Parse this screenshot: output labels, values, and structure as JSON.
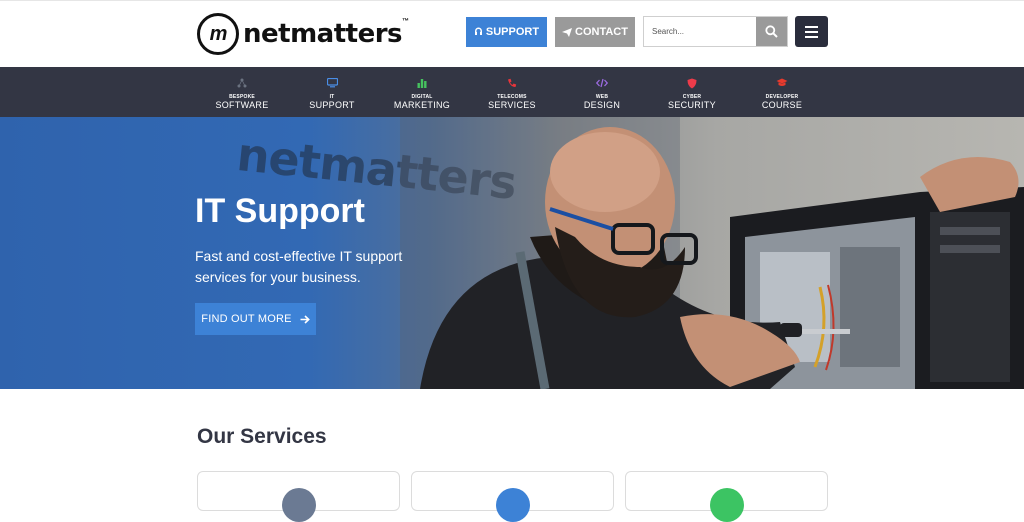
{
  "brand": {
    "name": "netmatters",
    "badge": "m",
    "tm": "™"
  },
  "header": {
    "support_label": "SUPPORT",
    "contact_label": "CONTACT",
    "search_placeholder": "Search..."
  },
  "nav": {
    "items": [
      {
        "small": "BESPOKE",
        "big": "SOFTWARE",
        "icon": "network-icon",
        "color": "#6b7280"
      },
      {
        "small": "IT",
        "big": "SUPPORT",
        "icon": "monitor-icon",
        "color": "#4a8ee6"
      },
      {
        "small": "DIGITAL",
        "big": "MARKETING",
        "icon": "bar-chart-icon",
        "color": "#46c35f"
      },
      {
        "small": "TELECOMS",
        "big": "SERVICES",
        "icon": "phone-icon",
        "color": "#e8353b"
      },
      {
        "small": "WEB",
        "big": "DESIGN",
        "icon": "code-icon",
        "color": "#9b6be0"
      },
      {
        "small": "CYBER",
        "big": "SECURITY",
        "icon": "shield-icon",
        "color": "#ee3b4a"
      },
      {
        "small": "DEVELOPER",
        "big": "COURSE",
        "icon": "graduation-cap-icon",
        "color": "#e83a2d"
      }
    ]
  },
  "hero": {
    "title": "IT Support",
    "subtitle": "Fast and cost-effective IT support services for your business.",
    "cta_label": "FIND OUT MORE",
    "wall_text": "netmatters"
  },
  "services": {
    "title": "Our Services",
    "card_colors": [
      "#6b7a93",
      "#3d82d6",
      "#3cc463"
    ]
  },
  "colors": {
    "accent_blue": "#3d82d6",
    "nav_bg": "#333644",
    "contact_grey": "#9a9a9a"
  }
}
